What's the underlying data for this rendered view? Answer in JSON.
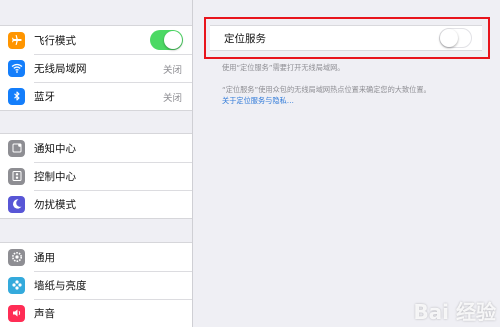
{
  "sidebar": {
    "groups": [
      {
        "items": [
          {
            "label": "飞行模式",
            "value": "",
            "icon": "airplane-icon",
            "icon_color": "#ff9500",
            "toggle": "on"
          },
          {
            "label": "无线局域网",
            "value": "关闭",
            "icon": "wifi-icon",
            "icon_color": "#147efb"
          },
          {
            "label": "蓝牙",
            "value": "关闭",
            "icon": "bluetooth-icon",
            "icon_color": "#147efb"
          }
        ]
      },
      {
        "items": [
          {
            "label": "通知中心",
            "icon": "notification-center-icon",
            "icon_color": "#8e8e93"
          },
          {
            "label": "控制中心",
            "icon": "control-center-icon",
            "icon_color": "#8e8e93"
          },
          {
            "label": "勿扰模式",
            "icon": "do-not-disturb-moon-icon",
            "icon_color": "#5856d6"
          }
        ]
      },
      {
        "items": [
          {
            "label": "通用",
            "icon": "gear-icon",
            "icon_color": "#8e8e93"
          },
          {
            "label": "墙纸与亮度",
            "icon": "wallpaper-flower-icon",
            "icon_color": "#34aadc"
          },
          {
            "label": "声音",
            "icon": "sound-speaker-icon",
            "icon_color": "#ff2d55"
          }
        ]
      }
    ]
  },
  "detail": {
    "location_label": "定位服务",
    "location_toggle": "off",
    "note1": "使用“定位服务”需要打开无线局域网。",
    "note2": "“定位服务”使用众包的无线局域网热点位置来确定您的大致位置。",
    "note2_link": "关于定位服务与隐私…",
    "highlight_color": "#e8141c"
  },
  "watermark": "Bai 经验"
}
